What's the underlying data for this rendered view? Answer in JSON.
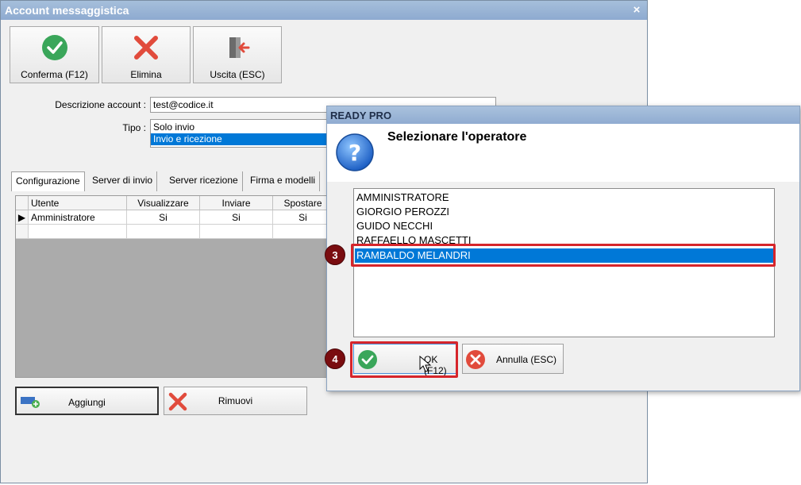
{
  "main": {
    "title": "Account messaggistica",
    "close_glyph": "×",
    "toolbar": {
      "confirm_label": "Conferma (F12)",
      "delete_label": "Elimina",
      "exit_label": "Uscita (ESC)"
    },
    "form": {
      "account_label": "Descrizione account :",
      "account_value": "test@codice.it",
      "type_label": "Tipo :",
      "type_options": [
        "Solo invio",
        "Invio e ricezione"
      ]
    },
    "tabs": [
      "Configurazione",
      "Server di invio",
      "Server ricezione",
      "Firma e modelli"
    ],
    "grid": {
      "headers": [
        "Utente",
        "Visualizzare",
        "Inviare",
        "Spostare"
      ],
      "rows": [
        [
          "Amministratore",
          "Si",
          "Si",
          "Si"
        ]
      ]
    },
    "add_label": "Aggiungi",
    "remove_label": "Rimuovi"
  },
  "dialog": {
    "title": "READY PRO",
    "heading": "Selezionare l'operatore",
    "operators": [
      "AMMINISTRATORE",
      "GIORGIO PEROZZI",
      "GUIDO NECCHI",
      "RAFFAELLO MASCETTI",
      "RAMBALDO MELANDRI"
    ],
    "ok_label": "OK (F12)",
    "cancel_label": "Annulla (ESC)"
  },
  "annotations": {
    "step3": "3",
    "step4": "4"
  },
  "colors": {
    "selection": "#0078d7",
    "highlight": "#d6252b",
    "badge": "#7a0d10"
  }
}
